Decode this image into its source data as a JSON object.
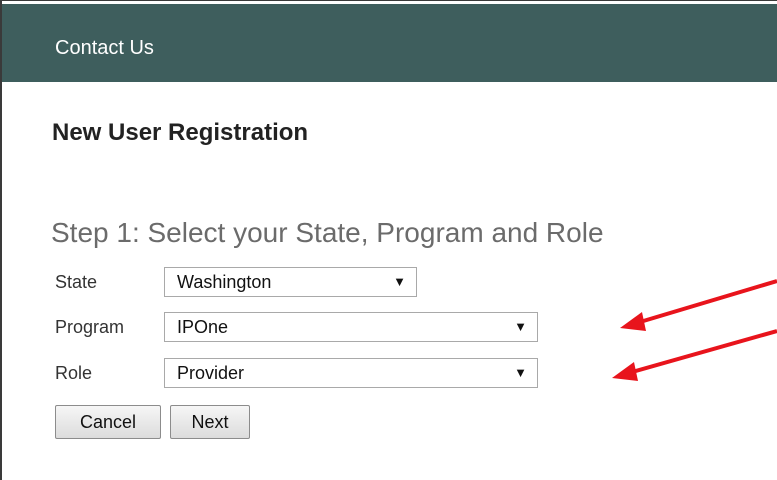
{
  "header": {
    "title": "Contact Us"
  },
  "page": {
    "title": "New User Registration",
    "step_title": "Step 1: Select your State, Program and Role"
  },
  "form": {
    "state": {
      "label": "State",
      "value": "Washington"
    },
    "program": {
      "label": "Program",
      "value": "IPOne"
    },
    "role": {
      "label": "Role",
      "value": "Provider"
    },
    "dropdown_glyph": "▼"
  },
  "buttons": {
    "cancel": "Cancel",
    "next": "Next"
  },
  "colors": {
    "header_bg": "#3e5e5d",
    "annotation_arrow": "#e8141c"
  },
  "annotations": {
    "arrow_count": 2
  }
}
